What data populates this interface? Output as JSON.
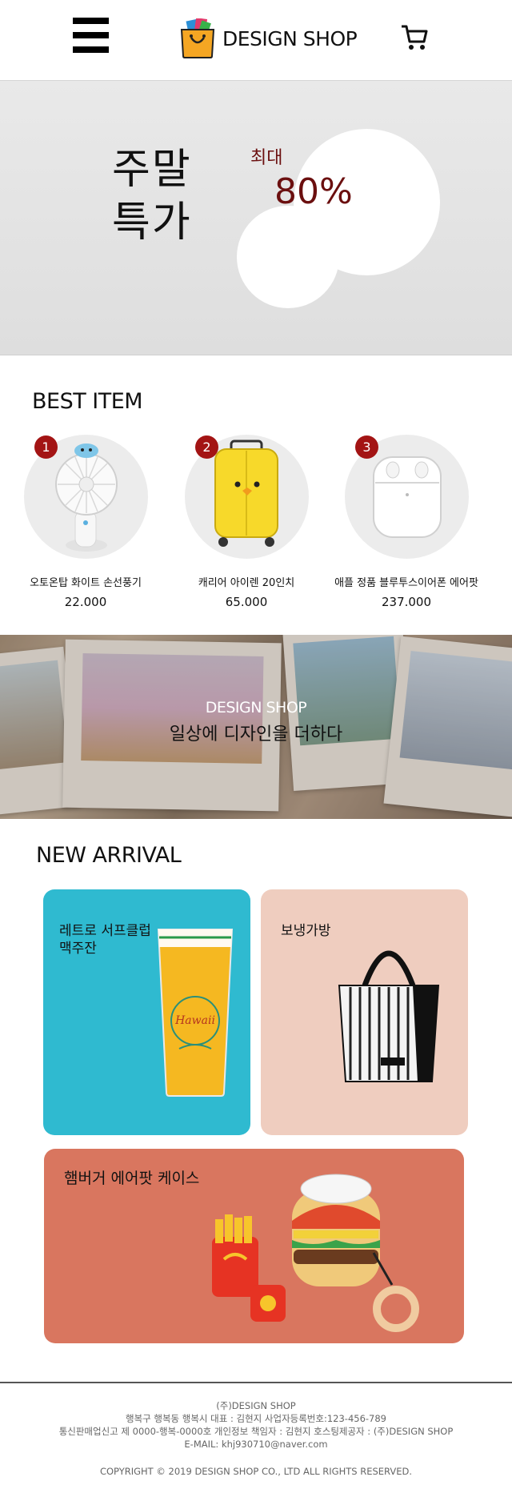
{
  "header": {
    "brand": "DESIGN SHOP",
    "menu_icon": "hamburger-menu-icon",
    "cart_icon": "shopping-cart-icon"
  },
  "hero": {
    "title_line1": "주말",
    "title_line2": "특가",
    "upto": "최대",
    "discount": "80%"
  },
  "best": {
    "title": "BEST ITEM",
    "items": [
      {
        "rank": "1",
        "name": "오토온탑 화이트 손선풍기",
        "price": "22.000",
        "icon": "handheld-fan-image"
      },
      {
        "rank": "2",
        "name": "캐리어 아이렌 20인치",
        "price": "65.000",
        "icon": "yellow-suitcase-image"
      },
      {
        "rank": "3",
        "name": "애플 정품 블루투스이어폰 에어팟",
        "price": "237.000",
        "icon": "airpods-image"
      }
    ]
  },
  "banner": {
    "brand": "DESIGN SHOP",
    "tagline": "일상에 디자인을 더하다"
  },
  "arrival": {
    "title": "NEW ARRIVAL",
    "items": [
      {
        "label_line1": "레트로 서프클럽",
        "label_line2": "맥주잔",
        "color": "#2fbad0",
        "icon": "beer-glass-image"
      },
      {
        "label_line1": "보냉가방",
        "label_line2": "",
        "color": "#efcdbf",
        "icon": "cooler-bag-image"
      },
      {
        "label_line1": "햄버거 에어팟 케이스",
        "label_line2": "",
        "color": "#d9765f",
        "icon": "hamburger-airpods-case-image"
      }
    ]
  },
  "footer": {
    "company": "(주)DESIGN SHOP",
    "address": "행복구 행복동 행복시  대표 : 김현지 사업자등록번호:123-456-789",
    "license": "통신판매업신고 제 0000-행복-0000호  개인정보 책임자 : 김현지 호스팅제공자 : (주)DESIGN SHOP",
    "email": "E-MAIL: khj930710@naver.com",
    "copyright": "COPYRIGHT © 2019 DESIGN SHOP CO., LTD ALL RIGHTS RESERVED."
  },
  "colors": {
    "accent_red": "#a31414",
    "discount_text": "#6b0f0f",
    "teal_tile": "#2fbad0",
    "peach_tile": "#efcdbf",
    "coral_tile": "#d9765f"
  }
}
